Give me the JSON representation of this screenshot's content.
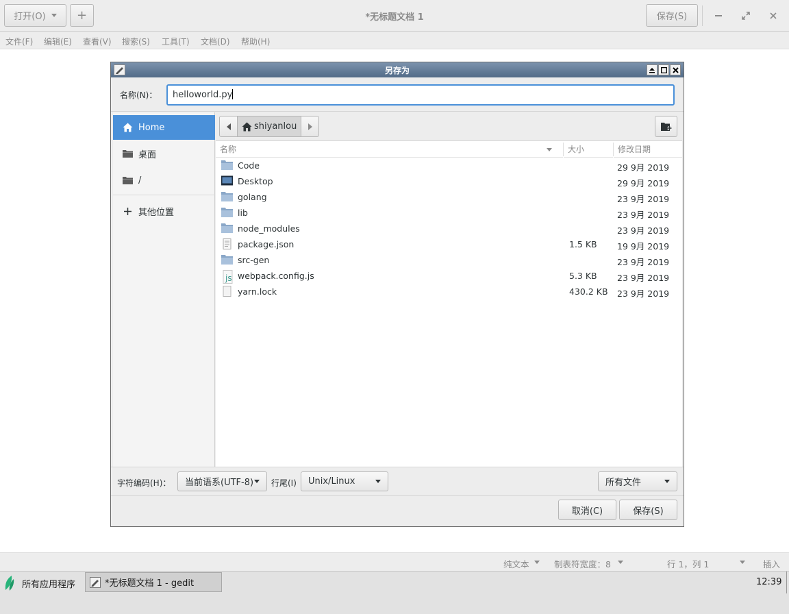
{
  "header": {
    "open_label": "打开(O)",
    "new_tab_label": "+",
    "title": "*无标题文档 1",
    "save_label": "保存(S)"
  },
  "menubar": [
    "文件(F)",
    "编辑(E)",
    "查看(V)",
    "搜索(S)",
    "工具(T)",
    "文档(D)",
    "帮助(H)"
  ],
  "dialog": {
    "title": "另存为",
    "name_label": "名称(N)：",
    "name_value": "helloworld.py",
    "sidebar": [
      "Home",
      "桌面",
      "/",
      "其他位置"
    ],
    "path_crumb": "shiyanlou",
    "columns": {
      "name": "名称",
      "size": "大小",
      "modified": "修改日期"
    },
    "files": [
      {
        "name": "Code",
        "size": "",
        "date": "29 9月 2019",
        "icon": "folder-icon"
      },
      {
        "name": "Desktop",
        "size": "",
        "date": "29 9月 2019",
        "icon": "desktop-folder-icon"
      },
      {
        "name": "golang",
        "size": "",
        "date": "23 9月 2019",
        "icon": "folder-icon"
      },
      {
        "name": "lib",
        "size": "",
        "date": "23 9月 2019",
        "icon": "folder-icon"
      },
      {
        "name": "node_modules",
        "size": "",
        "date": "23 9月 2019",
        "icon": "folder-icon"
      },
      {
        "name": "package.json",
        "size": "1.5 KB",
        "date": "19 9月 2019",
        "icon": "text-file-icon"
      },
      {
        "name": "src-gen",
        "size": "",
        "date": "23 9月 2019",
        "icon": "folder-icon"
      },
      {
        "name": "webpack.config.js",
        "size": "5.3 KB",
        "date": "23 9月 2019",
        "icon": "js-file-icon"
      },
      {
        "name": "yarn.lock",
        "size": "430.2 KB",
        "date": "23 9月 2019",
        "icon": "file-icon"
      }
    ],
    "encoding_label": "字符编码(H)：",
    "encoding_value": "当前语系(UTF-8)",
    "line_ending_label": "行尾(I)",
    "line_ending_value": "Unix/Linux",
    "filter_value": "所有文件",
    "cancel_label": "取消(C)",
    "save_label": "保存(S)"
  },
  "statusbar": {
    "language": "纯文本",
    "tab_width": "制表符宽度：8",
    "position": "行 1，列 1",
    "mode": "插入"
  },
  "taskbar": {
    "apps_label": "所有应用程序",
    "task_label": "*无标题文档 1 - gedit",
    "clock": "12:39"
  },
  "colors": {
    "selection": "#4a90d9",
    "dialog_title_bar": "#5f7895",
    "folder": "#8aa7c8"
  }
}
